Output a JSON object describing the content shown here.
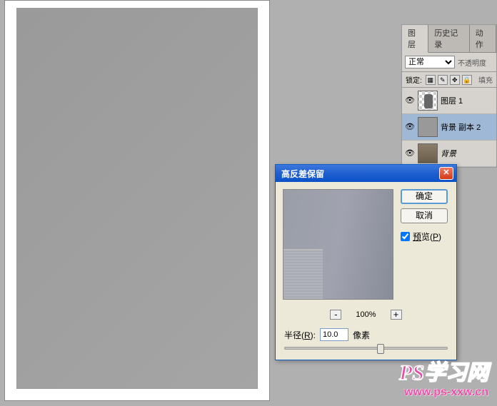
{
  "panel": {
    "tabs": {
      "layers": "图层",
      "history": "历史记录",
      "actions": "动作"
    },
    "blend_mode": "正常",
    "opacity_label": "不透明度",
    "lock_label": "锁定:",
    "fill_label": "填充",
    "layers": [
      {
        "name": "图层 1"
      },
      {
        "name": "背景 副本 2"
      },
      {
        "name": "背景"
      }
    ]
  },
  "dialog": {
    "title": "高反差保留",
    "ok": "确定",
    "cancel": "取消",
    "preview": "预览(P)",
    "zoom": "100%",
    "radius_label": "半径(R):",
    "radius_value": "10.0",
    "radius_unit": "像素"
  },
  "watermark": {
    "title": "PS学习网",
    "url": "www.ps-xxw.cn"
  }
}
